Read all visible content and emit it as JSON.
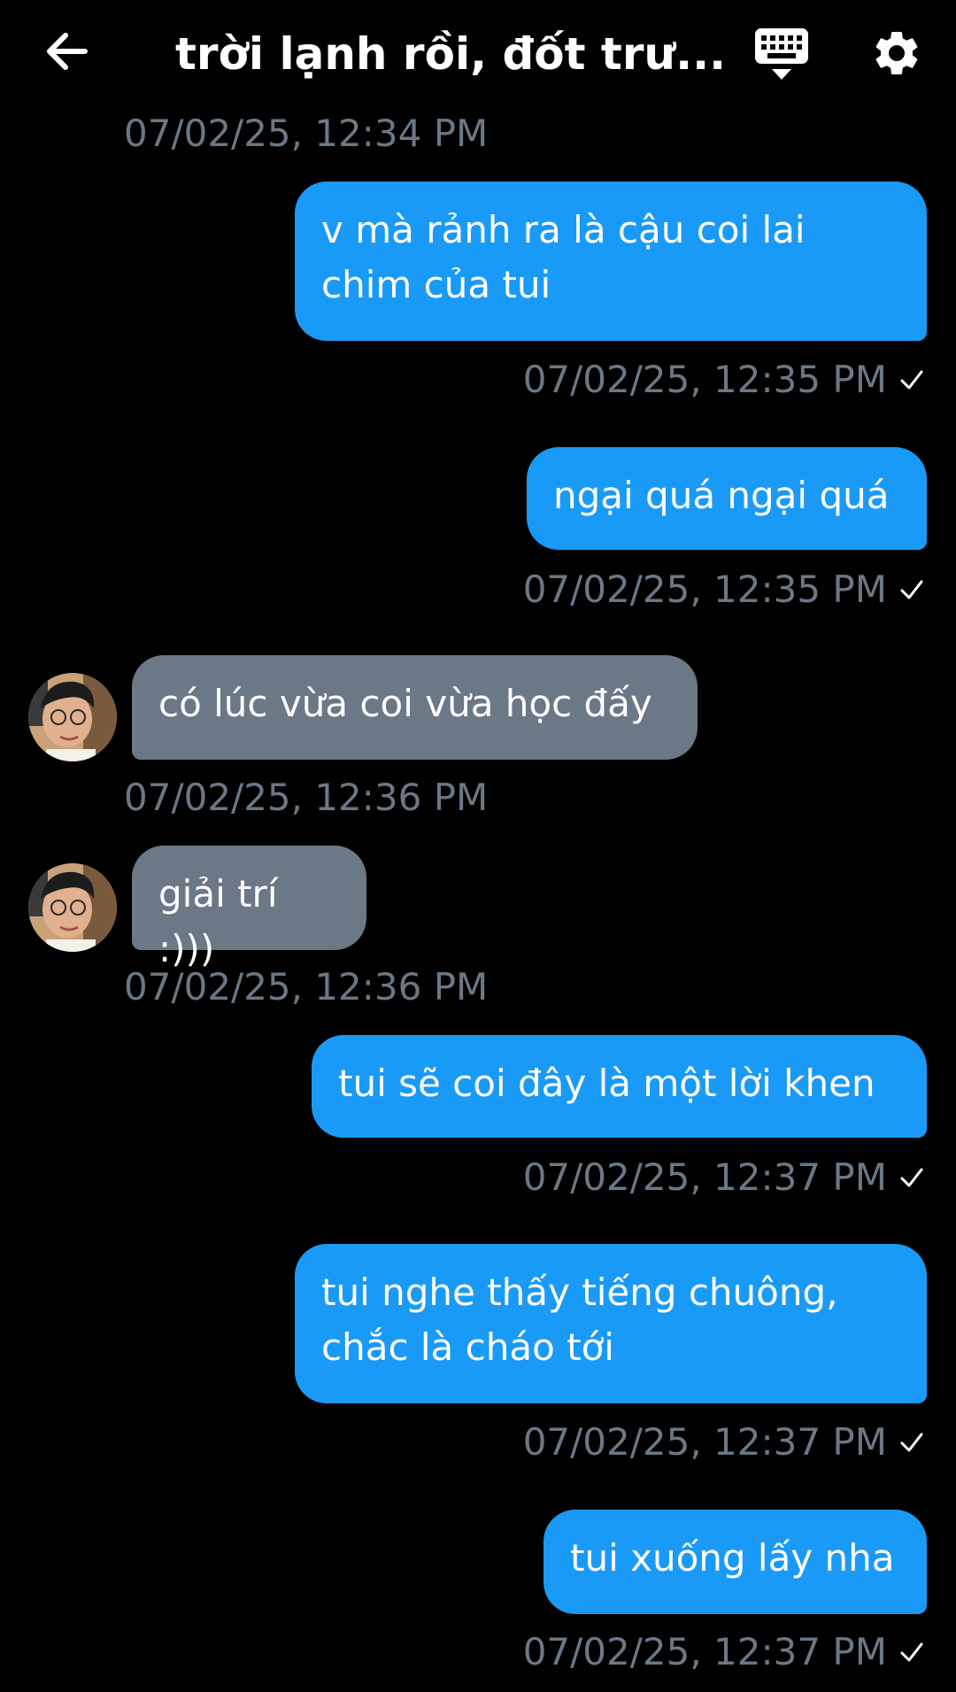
{
  "header": {
    "title": "trời lạnh rồi, đốt trư..."
  },
  "icons": {
    "back": "arrow-left-icon",
    "keyboard": "keyboard-icon",
    "settings": "gear-icon",
    "check": "check-icon"
  },
  "colors": {
    "background": "#000000",
    "outgoing_bubble": "#1a9af7",
    "incoming_bubble": "#6b7885",
    "timestamp": "#6b7885"
  },
  "messages": [
    {
      "direction": "in",
      "timestamp": "07/02/25, 12:34 PM"
    },
    {
      "direction": "out",
      "text": "v mà rảnh ra là cậu coi lai chim của tui",
      "line1": "v mà rảnh ra là cậu coi lai",
      "line2": "chim của tui",
      "timestamp": "07/02/25, 12:35 PM"
    },
    {
      "direction": "out",
      "text": "ngại quá ngại quá",
      "timestamp": "07/02/25, 12:35 PM"
    },
    {
      "direction": "in",
      "text": "có lúc vừa coi vừa học đấy",
      "timestamp": "07/02/25, 12:36 PM"
    },
    {
      "direction": "in",
      "text": "giải trí :)))",
      "timestamp": "07/02/25, 12:36 PM"
    },
    {
      "direction": "out",
      "text": "tui sẽ coi đây là một lời khen",
      "timestamp": "07/02/25, 12:37 PM"
    },
    {
      "direction": "out",
      "text": "tui nghe thấy tiếng chuông, chắc là cháo tới",
      "line1": "tui nghe thấy tiếng chuông,",
      "line2": "chắc là cháo tới",
      "timestamp": "07/02/25, 12:37 PM"
    },
    {
      "direction": "out",
      "text": "tui xuống lấy nha",
      "timestamp": "07/02/25, 12:37 PM"
    }
  ]
}
